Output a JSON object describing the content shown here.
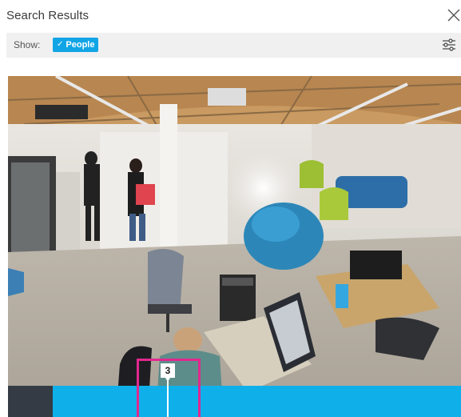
{
  "header": {
    "title": "Search Results"
  },
  "filters": {
    "show_label": "Show:",
    "chip_label": "People",
    "chip_check": "✓"
  },
  "timeline": {
    "marker_number": "3"
  },
  "colors": {
    "accent": "#12a5e6",
    "timeline": "#0fb0ea",
    "highlight": "#e2278f"
  }
}
